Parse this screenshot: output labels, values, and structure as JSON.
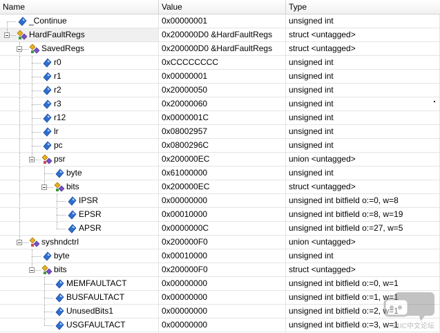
{
  "columns": {
    "name": "Name",
    "value": "Value",
    "type": "Type"
  },
  "rows": [
    {
      "depth": 0,
      "kind": "var",
      "expander": false,
      "name": "_Continue",
      "value": "0x00000001",
      "type": "unsigned int"
    },
    {
      "depth": 0,
      "kind": "struct",
      "expander": true,
      "name": "HardFaultRegs",
      "value": "0x200000D0 &HardFaultRegs",
      "type": "struct <untagged>",
      "selected": true
    },
    {
      "depth": 1,
      "kind": "struct",
      "expander": true,
      "name": "SavedRegs",
      "value": "0x200000D0 &HardFaultRegs",
      "type": "struct <untagged>"
    },
    {
      "depth": 2,
      "kind": "var",
      "expander": false,
      "name": "r0",
      "value": "0xCCCCCCCC",
      "type": "unsigned int"
    },
    {
      "depth": 2,
      "kind": "var",
      "expander": false,
      "name": "r1",
      "value": "0x00000001",
      "type": "unsigned int"
    },
    {
      "depth": 2,
      "kind": "var",
      "expander": false,
      "name": "r2",
      "value": "0x20000050",
      "type": "unsigned int"
    },
    {
      "depth": 2,
      "kind": "var",
      "expander": false,
      "name": "r3",
      "value": "0x20000060",
      "type": "unsigned int"
    },
    {
      "depth": 2,
      "kind": "var",
      "expander": false,
      "name": "r12",
      "value": "0x0000001C",
      "type": "unsigned int"
    },
    {
      "depth": 2,
      "kind": "var",
      "expander": false,
      "name": "lr",
      "value": "0x08002957",
      "type": "unsigned int"
    },
    {
      "depth": 2,
      "kind": "var",
      "expander": false,
      "name": "pc",
      "value": "0x0800296C",
      "type": "unsigned int"
    },
    {
      "depth": 2,
      "kind": "union",
      "expander": true,
      "name": "psr",
      "value": "0x200000EC",
      "type": "union <untagged>"
    },
    {
      "depth": 3,
      "kind": "var",
      "expander": false,
      "name": "byte",
      "value": "0x61000000",
      "type": "unsigned int"
    },
    {
      "depth": 3,
      "kind": "struct",
      "expander": true,
      "name": "bits",
      "value": "0x200000EC",
      "type": "struct <untagged>"
    },
    {
      "depth": 4,
      "kind": "var",
      "expander": false,
      "name": "IPSR",
      "value": "0x00000000",
      "type": "unsigned int bitfield o:=0, w=8"
    },
    {
      "depth": 4,
      "kind": "var",
      "expander": false,
      "name": "EPSR",
      "value": "0x00010000",
      "type": "unsigned int bitfield o:=8, w=19"
    },
    {
      "depth": 4,
      "kind": "var",
      "expander": false,
      "name": "APSR",
      "value": "0x0000000C",
      "type": "unsigned int bitfield o:=27, w=5"
    },
    {
      "depth": 1,
      "kind": "union",
      "expander": true,
      "name": "syshndctrl",
      "value": "0x200000F0",
      "type": "union <untagged>"
    },
    {
      "depth": 2,
      "kind": "var",
      "expander": false,
      "name": "byte",
      "value": "0x00010000",
      "type": "unsigned int"
    },
    {
      "depth": 2,
      "kind": "struct",
      "expander": true,
      "name": "bits",
      "value": "0x200000F0",
      "type": "struct <untagged>"
    },
    {
      "depth": 3,
      "kind": "var",
      "expander": false,
      "name": "MEMFAULTACT",
      "value": "0x00000000",
      "type": "unsigned int bitfield o:=0, w=1"
    },
    {
      "depth": 3,
      "kind": "var",
      "expander": false,
      "name": "BUSFAULTACT",
      "value": "0x00000000",
      "type": "unsigned int bitfield o:=1, w=1"
    },
    {
      "depth": 3,
      "kind": "var",
      "expander": false,
      "name": "UnusedBits1",
      "value": "0x00000000",
      "type": "unsigned int bitfield o:=2, w=1"
    },
    {
      "depth": 3,
      "kind": "var",
      "expander": false,
      "name": "USGFAULTACT",
      "value": "0x00000000",
      "type": "unsigned int bitfield o:=3, w=1"
    }
  ],
  "colors": {
    "var_icon": "#2f6fd0",
    "struct_icon_a": "#e8b020",
    "struct_icon_b": "#7a4fc8",
    "header_border": "#d5d5d5"
  },
  "watermark": {
    "text": "21IC中文论坛",
    "icon": "chat-bubble-icon"
  }
}
